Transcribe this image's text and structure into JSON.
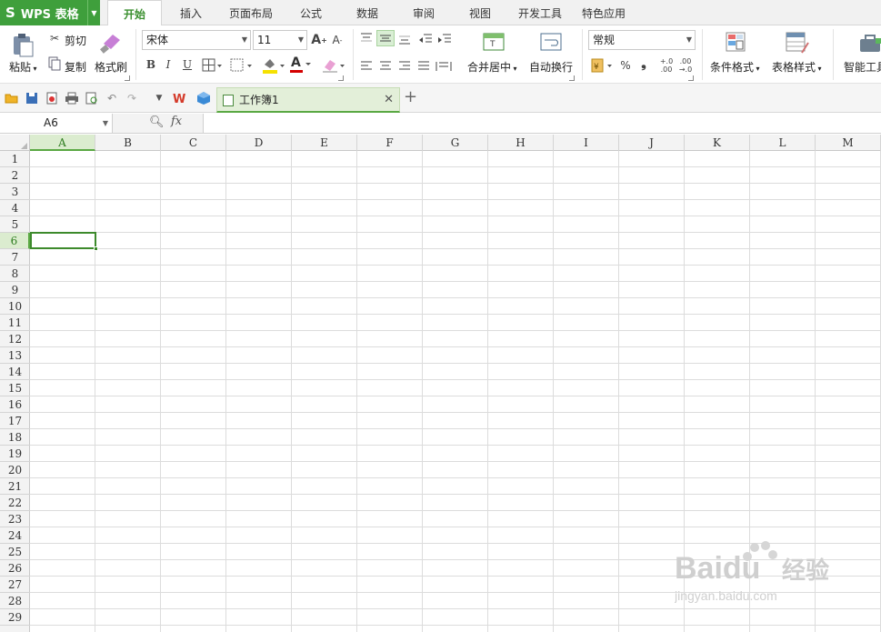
{
  "app": {
    "logo": "S",
    "name": "WPS 表格"
  },
  "ribbon_tabs": [
    "开始",
    "插入",
    "页面布局",
    "公式",
    "数据",
    "审阅",
    "视图",
    "开发工具",
    "特色应用"
  ],
  "clipboard": {
    "paste": "粘贴",
    "cut": "剪切",
    "copy": "复制",
    "format_painter": "格式刷"
  },
  "font": {
    "name": "宋体",
    "size": "11",
    "bold": "B",
    "italic": "I",
    "underline": "U",
    "grow": "A",
    "shrink": "A",
    "font_color_glyph": "A"
  },
  "alignment": {
    "merge_center": "合并居中",
    "wrap_text": "自动换行"
  },
  "number": {
    "format": "常规",
    "percent": "%",
    "comma": "❟",
    "inc_decimal": "+.0\n.00",
    "dec_decimal": ".00\n→.0"
  },
  "styles": {
    "conditional_format": "条件格式",
    "table_style": "表格样式",
    "smart_toolbox": "智能工具"
  },
  "doc_tab": {
    "name": "工作簿1"
  },
  "formula_bar": {
    "cell_ref": "A6",
    "fx": "fx",
    "value": ""
  },
  "grid": {
    "columns": [
      "A",
      "B",
      "C",
      "D",
      "E",
      "F",
      "G",
      "H",
      "I",
      "J",
      "K",
      "L",
      "M"
    ],
    "rows": [
      "1",
      "2",
      "3",
      "4",
      "5",
      "6",
      "7",
      "8",
      "9",
      "10",
      "11",
      "12",
      "13",
      "14",
      "15",
      "16",
      "17",
      "18",
      "19",
      "20",
      "21",
      "22",
      "23",
      "24",
      "25",
      "26",
      "27",
      "28",
      "29"
    ],
    "active_cell": "A6"
  },
  "watermark": {
    "brand": "Baidu",
    "suffix": "经验",
    "url": "jingyan.baidu.com"
  },
  "colors": {
    "accent": "#3f9f3c",
    "selection": "#3d8a2c",
    "header_bg": "#f3f3f3"
  }
}
